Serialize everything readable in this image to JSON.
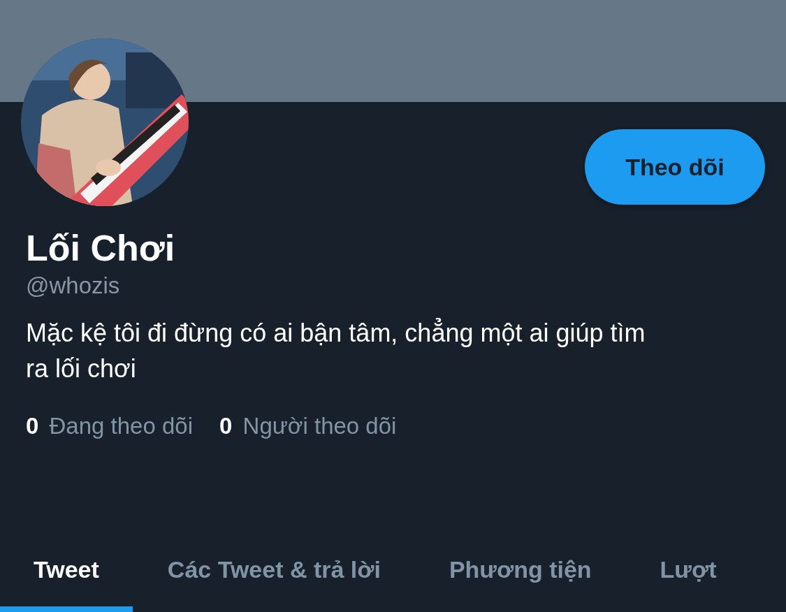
{
  "profile": {
    "follow_button": "Theo dõi",
    "name": "Lối Chơi",
    "handle": "@whozis",
    "bio": "Mặc kệ tôi đi đừng có ai bận tâm, chẳng một ai giúp tìm ra lối chơi"
  },
  "stats": [
    {
      "count": "0",
      "label": "Đang theo dõi"
    },
    {
      "count": "0",
      "label": "Người theo dõi"
    }
  ],
  "tabs": [
    {
      "label": "Tweet",
      "selected": true
    },
    {
      "label": "Các Tweet & trả lời",
      "selected": false
    },
    {
      "label": "Phương tiện",
      "selected": false
    },
    {
      "label": "Lượt",
      "selected": false
    }
  ]
}
